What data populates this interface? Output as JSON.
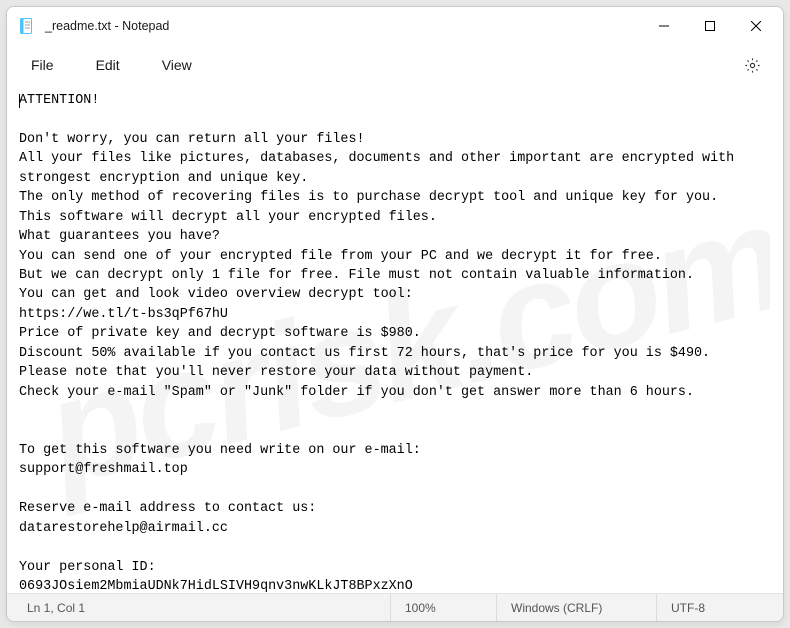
{
  "window": {
    "title": "_readme.txt - Notepad"
  },
  "menu": {
    "file": "File",
    "edit": "Edit",
    "view": "View"
  },
  "content": {
    "text": "ATTENTION!\n\nDon't worry, you can return all your files!\nAll your files like pictures, databases, documents and other important are encrypted with strongest encryption and unique key.\nThe only method of recovering files is to purchase decrypt tool and unique key for you.\nThis software will decrypt all your encrypted files.\nWhat guarantees you have?\nYou can send one of your encrypted file from your PC and we decrypt it for free.\nBut we can decrypt only 1 file for free. File must not contain valuable information.\nYou can get and look video overview decrypt tool:\nhttps://we.tl/t-bs3qPf67hU\nPrice of private key and decrypt software is $980.\nDiscount 50% available if you contact us first 72 hours, that's price for you is $490.\nPlease note that you'll never restore your data without payment.\nCheck your e-mail \"Spam\" or \"Junk\" folder if you don't get answer more than 6 hours.\n\n\nTo get this software you need write on our e-mail:\nsupport@freshmail.top\n\nReserve e-mail address to contact us:\ndatarestorehelp@airmail.cc\n\nYour personal ID:\n0693JOsiem2MbmiaUDNk7HidLSIVH9qnv3nwKLkJT8BPxzXnO"
  },
  "status": {
    "position": "Ln 1, Col 1",
    "zoom": "100%",
    "lineending": "Windows (CRLF)",
    "encoding": "UTF-8"
  },
  "watermark": "pcrisk.com"
}
